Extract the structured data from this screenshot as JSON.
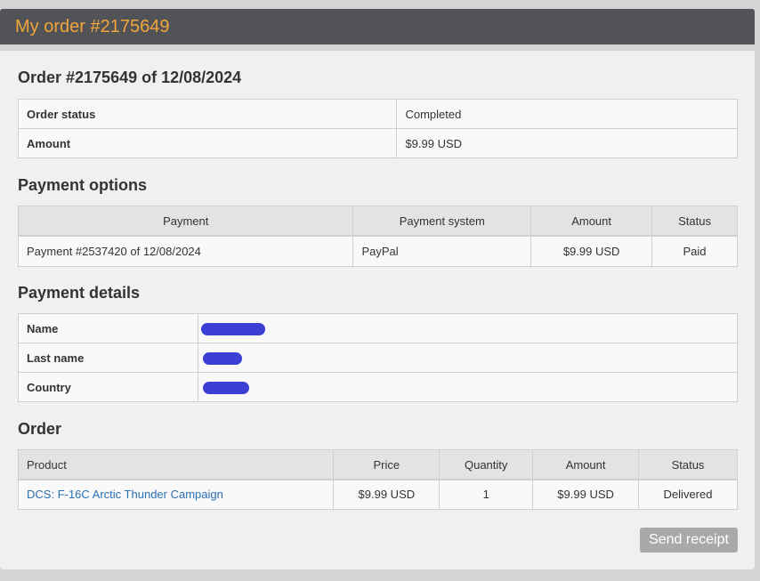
{
  "header": {
    "title": "My order #2175649"
  },
  "order_summary": {
    "heading": "Order #2175649 of 12/08/2024",
    "rows": [
      {
        "label": "Order status",
        "value": "Completed"
      },
      {
        "label": "Amount",
        "value": "$9.99 USD"
      }
    ]
  },
  "payment_options": {
    "heading": "Payment options",
    "columns": [
      "Payment",
      "Payment system",
      "Amount",
      "Status"
    ],
    "rows": [
      [
        "Payment #2537420 of 12/08/2024",
        "PayPal",
        "$9.99 USD",
        "Paid"
      ]
    ]
  },
  "payment_details": {
    "heading": "Payment details",
    "rows": [
      {
        "label": "Name",
        "redacted": true
      },
      {
        "label": "Last name",
        "redacted": true
      },
      {
        "label": "Country",
        "redacted": true
      }
    ],
    "redaction_color": "#3b3fd4"
  },
  "order_items": {
    "heading": "Order",
    "columns": [
      "Product",
      "Price",
      "Quantity",
      "Amount",
      "Status"
    ],
    "rows": [
      [
        "DCS: F-16C Arctic Thunder Campaign",
        "$9.99 USD",
        "1",
        "$9.99 USD",
        "Delivered"
      ]
    ]
  },
  "actions": {
    "send_receipt_label": "Send receipt"
  },
  "colors": {
    "header_bg": "#525357",
    "header_title": "#f2a53c",
    "link": "#2a6fb3",
    "button_bg": "#a9a9ab"
  }
}
